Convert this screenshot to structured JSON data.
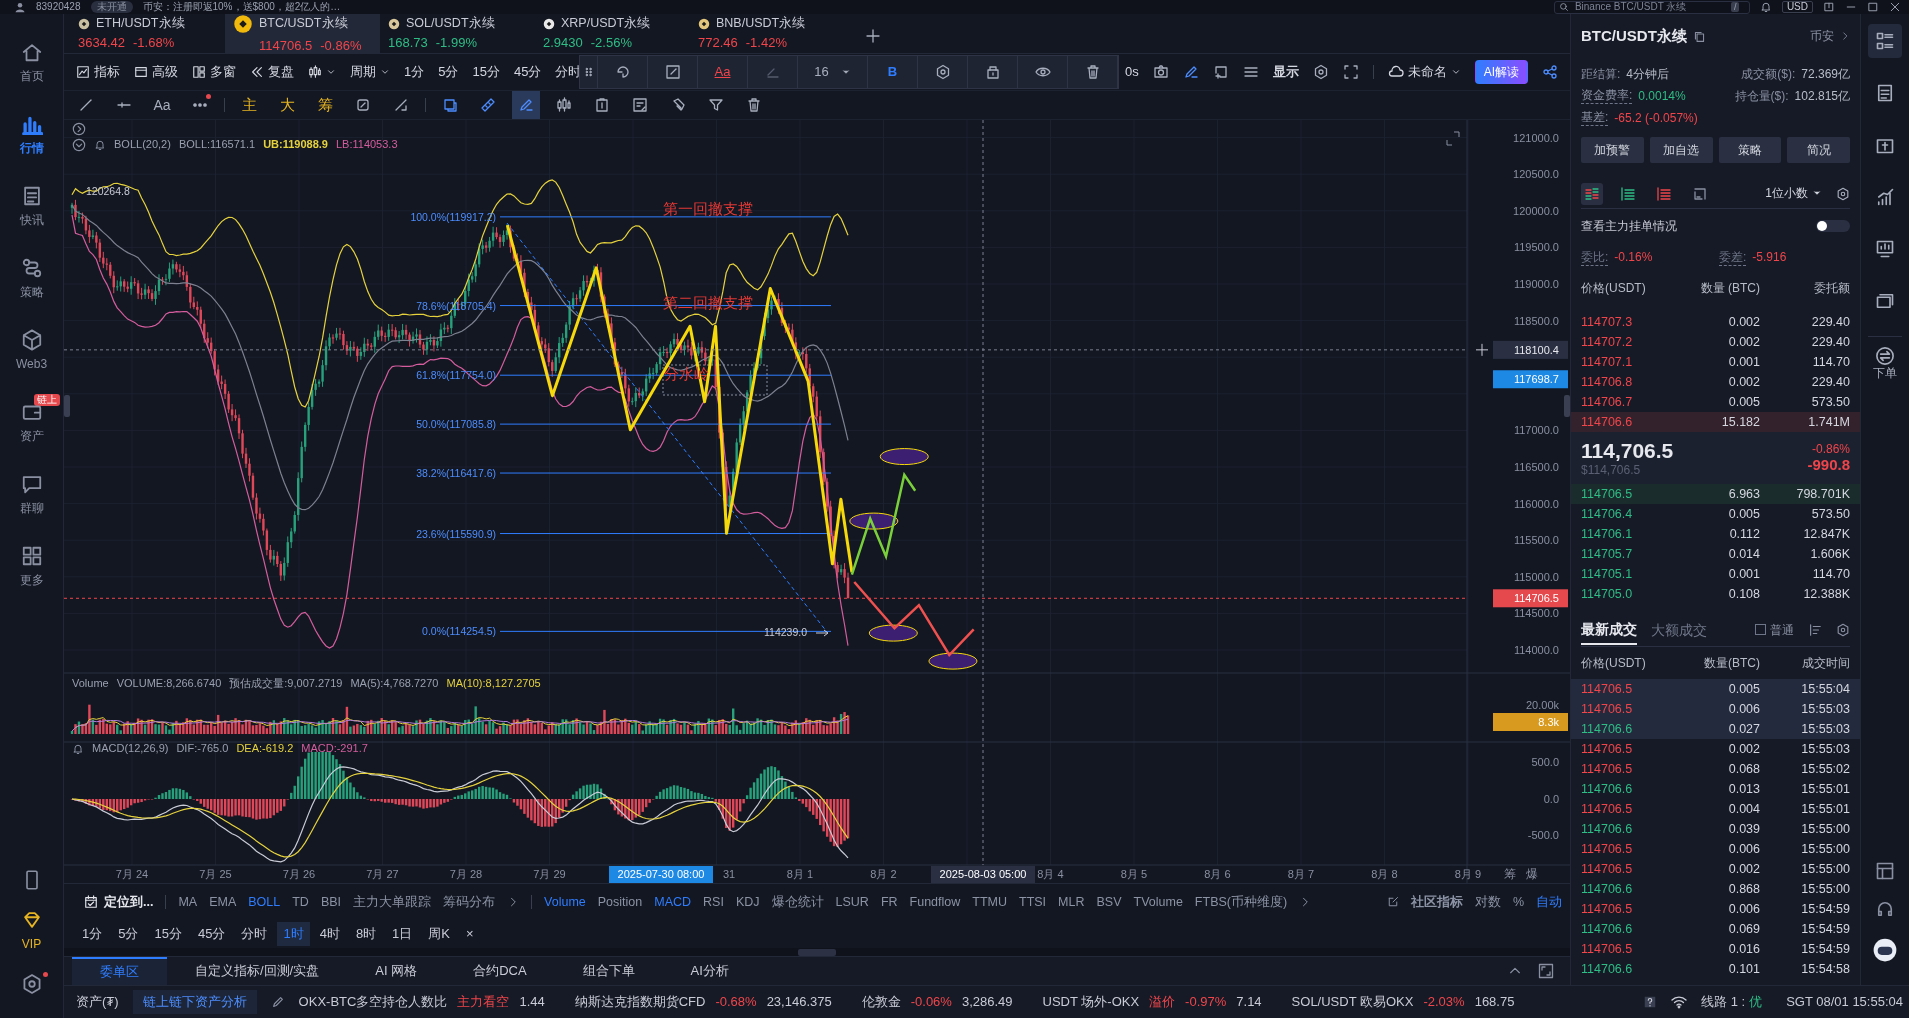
{
  "top_strip": {
    "account_id": "83920428",
    "account_status": "未开通",
    "news": "币安：注册即返10%，送$800，超2亿人的…",
    "search_placeholder": "Binance BTC/USDT 永续",
    "search_shortcut": "/",
    "currency": "USD"
  },
  "sidebar": {
    "items": [
      {
        "label": "首页",
        "kind": "home",
        "selected": false
      },
      {
        "label": "行情",
        "kind": "market",
        "selected": true
      },
      {
        "label": "快讯",
        "kind": "news",
        "selected": false
      },
      {
        "label": "策略",
        "kind": "strategy",
        "selected": false
      },
      {
        "label": "Web3",
        "kind": "web3",
        "selected": false
      },
      {
        "label": "资产",
        "kind": "assets",
        "selected": false,
        "badge": "链上"
      },
      {
        "label": "群聊",
        "kind": "chat",
        "selected": false
      },
      {
        "label": "更多",
        "kind": "more",
        "selected": false
      }
    ],
    "vip_label": "VIP",
    "settings_notice": true
  },
  "symbol_tabs": [
    {
      "name": "ETH/USDT永续",
      "kind": "eth",
      "price": "3634.42",
      "change": "-1.68%",
      "color": "#f0454a",
      "selected": false
    },
    {
      "name": "BTC/USDT永续",
      "kind": "btc",
      "price": "114706.5",
      "change": "-0.86%",
      "color": "#f0454a",
      "selected": true
    },
    {
      "name": "SOL/USDT永续",
      "kind": "sol",
      "price": "168.73",
      "change": "-1.99%",
      "color": "#2ebd85",
      "selected": false
    },
    {
      "name": "XRP/USDT永续",
      "kind": "xrp",
      "price": "2.9430",
      "change": "-2.56%",
      "color": "#2ebd85",
      "selected": false
    },
    {
      "name": "BNB/USDT永续",
      "kind": "bnb",
      "price": "772.46",
      "change": "-1.42%",
      "color": "#f0454a",
      "selected": false
    }
  ],
  "toolbar": {
    "buttons": [
      {
        "kind": "indicator",
        "label": "指标"
      },
      {
        "kind": "advanced",
        "label": "高级"
      },
      {
        "kind": "multi",
        "label": "多窗"
      },
      {
        "kind": "replay",
        "label": "复盘"
      }
    ],
    "period_label": "周期",
    "periods": [
      "1分",
      "5分",
      "15分",
      "45分",
      "分时"
    ],
    "countdown": "0s",
    "display_label": "显示",
    "layout_name": "未命名",
    "ai_button": "AI解读"
  },
  "float_toolbar": {
    "text_style": "Aa",
    "font_size": "16",
    "bold": "B"
  },
  "draw_toolbar": {
    "lead_tools": [
      {
        "kind": "line",
        "selected": false
      },
      {
        "kind": "hline",
        "selected": false
      }
    ],
    "text_tool": "Aa",
    "more_notice": true,
    "overlays": [
      "主",
      "大",
      "筹"
    ],
    "mid_tools": [
      {
        "kind": "cycle",
        "selected": false
      },
      {
        "kind": "measure",
        "selected": false
      }
    ],
    "tools": [
      {
        "kind": "select",
        "selected": false
      },
      {
        "kind": "ruler",
        "selected": false
      },
      {
        "kind": "pen",
        "selected": true
      },
      {
        "kind": "candles",
        "selected": false
      },
      {
        "kind": "upload",
        "selected": false
      },
      {
        "kind": "note",
        "selected": false
      },
      {
        "kind": "magnet",
        "selected": false
      },
      {
        "kind": "filter",
        "selected": false
      },
      {
        "kind": "trash",
        "selected": false
      }
    ]
  },
  "chart": {
    "main_header": {
      "indicator": "BOLL(20,2)",
      "mid": "BOLL:116571.1",
      "upper": "UB:119088.9",
      "lower": "LB:114053.3"
    },
    "high_label": "120264.8",
    "low_label": "114239.0",
    "fib_levels": [
      "100.0%(119917.2)",
      "78.6%(118705.4)",
      "61.8%(117754.0)",
      "50.0%(117085.8)",
      "38.2%(116417.6)",
      "23.6%(115590.9)",
      "0.0%(114254.5)"
    ],
    "annotations": [
      "第一回撤支撑",
      "第二回撤支撑",
      "分水岭"
    ],
    "price_ticks": [
      "121000.0",
      "120500.0",
      "120000.0",
      "119500.0",
      "119000.0",
      "118500.0",
      "117000.0",
      "116500.0",
      "116000.0",
      "115500.0",
      "115000.0",
      "114500.0",
      "114000.0"
    ],
    "crosshair_price": "118100.4",
    "marked_price": "117698.7",
    "last_price": "114706.5",
    "volume_header": {
      "title": "Volume",
      "volume": "VOLUME:8,266.6740",
      "estimate": "预估成交量:9,007.2719",
      "ma5": "MA(5):4,768.7270",
      "ma10": "MA(10):8,127.2705"
    },
    "volume_tick": "20.00k",
    "volume_last": "8.3k",
    "macd_header": {
      "title": "MACD(12,26,9)",
      "dif": "DIF:-765.0",
      "dea": "DEA:-619.2",
      "macd": "MACD:-291.7"
    },
    "macd_ticks": [
      "500.0",
      "0.0",
      "-500.0"
    ],
    "date_labels": [
      "7月 24",
      "7月 25",
      "7月 26",
      "7月 27",
      "7月 28",
      "7月 29",
      "31",
      "8月 1",
      "8月 2",
      "8月 4",
      "8月 5",
      "8月 6",
      "8月 7",
      "8月 8",
      "8月 9"
    ],
    "crosshair_date": "2025-07-30 08:00",
    "cursor_date": "2025-08-03 05:00",
    "axis_buttons": [
      "筹",
      "爆"
    ]
  },
  "bottom": {
    "locate": "定位到...",
    "main_indicators": [
      {
        "label": "MA",
        "active": false
      },
      {
        "label": "EMA",
        "active": false
      },
      {
        "label": "BOLL",
        "active": true
      },
      {
        "label": "TD",
        "active": false
      },
      {
        "label": "BBI",
        "active": false
      },
      {
        "label": "主力大单跟踪",
        "active": false
      },
      {
        "label": "筹码分布",
        "active": false
      }
    ],
    "sub_indicators": [
      {
        "label": "Volume",
        "active": true
      },
      {
        "label": "Position",
        "active": false
      },
      {
        "label": "MACD",
        "active": true
      },
      {
        "label": "RSI",
        "active": false
      },
      {
        "label": "KDJ",
        "active": false
      },
      {
        "label": "爆仓统计",
        "active": false
      },
      {
        "label": "LSUR",
        "active": false
      },
      {
        "label": "FR",
        "active": false
      },
      {
        "label": "Fundflow",
        "active": false
      },
      {
        "label": "TTMU",
        "active": false
      },
      {
        "label": "TTSI",
        "active": false
      },
      {
        "label": "MLR",
        "active": false
      },
      {
        "label": "BSV",
        "active": false
      },
      {
        "label": "TVolume",
        "active": false
      },
      {
        "label": "FTBS(币种维度)",
        "active": false
      }
    ],
    "community": "社区指标",
    "log": "对数",
    "percent": "%",
    "auto": {
      "label": "自动",
      "active": true
    },
    "periods": [
      {
        "label": "1分",
        "selected": false
      },
      {
        "label": "5分",
        "selected": false
      },
      {
        "label": "15分",
        "selected": false
      },
      {
        "label": "45分",
        "selected": false
      },
      {
        "label": "分时",
        "selected": false
      },
      {
        "label": "1时",
        "selected": true
      },
      {
        "label": "4时",
        "selected": false
      },
      {
        "label": "8时",
        "selected": false
      },
      {
        "label": "1日",
        "selected": false
      },
      {
        "label": "周K",
        "selected": false
      }
    ],
    "close": "×",
    "panel_tabs": [
      {
        "label": "委单区",
        "selected": true
      },
      {
        "label": "自定义指标/回测/实盘",
        "selected": false
      },
      {
        "label": "AI 网格",
        "selected": false
      },
      {
        "label": "合约DCA",
        "selected": false
      },
      {
        "label": "组合下单",
        "selected": false
      },
      {
        "label": "AI分析",
        "selected": false
      }
    ]
  },
  "right_panel": {
    "title": "BTC/USDT永续",
    "exchange": "币安",
    "stats": [
      {
        "label": "距结算:",
        "value": "4分钟后",
        "color": "#b8bdca"
      },
      {
        "label": "成交额($):",
        "value": "72.369亿",
        "color": "#b8bdca"
      },
      {
        "label": "资金费率:",
        "value": "0.0014%",
        "color": "#2ebd85"
      },
      {
        "label": "持仓量($):",
        "value": "102.815亿",
        "color": "#b8bdca"
      },
      {
        "label": "基差:",
        "value": "-65.2 (-0.057%)",
        "color": "#f0454a"
      }
    ],
    "buttons": [
      "加预警",
      "加自选",
      "策略",
      "简况"
    ],
    "book_views": [
      {
        "kind": "both",
        "selected": true
      },
      {
        "kind": "bids",
        "selected": false
      },
      {
        "kind": "asks",
        "selected": false
      },
      {
        "kind": "depth",
        "selected": false
      }
    ],
    "precision": "1位小数",
    "whale_toggle": {
      "label": "查看主力挂单情况",
      "on": false
    },
    "ratio": {
      "label": "委比:",
      "value": "-0.16%"
    },
    "diff": {
      "label": "委差:",
      "value": "-5.916"
    },
    "columns": [
      "价格(USDT)",
      "数量 (BTC)",
      "委托额"
    ],
    "asks": [
      {
        "price": "114707.3",
        "amount": "0.002",
        "total": "229.40",
        "highlighted": false
      },
      {
        "price": "114707.2",
        "amount": "0.002",
        "total": "229.40",
        "highlighted": false
      },
      {
        "price": "114707.1",
        "amount": "0.001",
        "total": "114.70",
        "highlighted": false
      },
      {
        "price": "114706.8",
        "amount": "0.002",
        "total": "229.40",
        "highlighted": false
      },
      {
        "price": "114706.7",
        "amount": "0.005",
        "total": "573.50",
        "highlighted": false
      },
      {
        "price": "114706.6",
        "amount": "15.182",
        "total": "1.741M",
        "highlighted": true
      }
    ],
    "mid": {
      "price": "114,706.5",
      "usd": "$114,706.5",
      "change_pct": "-0.86%",
      "change": "-990.8"
    },
    "bids": [
      {
        "price": "114706.5",
        "amount": "6.963",
        "total": "798.701K",
        "highlighted": true
      },
      {
        "price": "114706.4",
        "amount": "0.005",
        "total": "573.50",
        "highlighted": false
      },
      {
        "price": "114706.1",
        "amount": "0.112",
        "total": "12.847K",
        "highlighted": false
      },
      {
        "price": "114705.7",
        "amount": "0.014",
        "total": "1.606K",
        "highlighted": false
      },
      {
        "price": "114705.1",
        "amount": "0.001",
        "total": "114.70",
        "highlighted": false
      },
      {
        "price": "114705.0",
        "amount": "0.108",
        "total": "12.388K",
        "highlighted": false
      }
    ],
    "trade_tabs": [
      {
        "label": "最新成交",
        "selected": true
      },
      {
        "label": "大额成交",
        "selected": false
      }
    ],
    "normal_filter": {
      "label": "普通",
      "checked": false
    },
    "trade_columns": [
      "价格(USDT)",
      "数量(BTC)",
      "成交时间"
    ],
    "trades": [
      {
        "price": "114706.5",
        "amount": "0.005",
        "time": "15:55:04",
        "kind": "sell",
        "highlighted": true
      },
      {
        "price": "114706.5",
        "amount": "0.006",
        "time": "15:55:03",
        "kind": "sell",
        "highlighted": true
      },
      {
        "price": "114706.6",
        "amount": "0.027",
        "time": "15:55:03",
        "kind": "buy",
        "highlighted": true
      },
      {
        "price": "114706.5",
        "amount": "0.002",
        "time": "15:55:03",
        "kind": "sell",
        "highlighted": false
      },
      {
        "price": "114706.5",
        "amount": "0.068",
        "time": "15:55:02",
        "kind": "sell",
        "highlighted": false
      },
      {
        "price": "114706.6",
        "amount": "0.013",
        "time": "15:55:01",
        "kind": "buy",
        "highlighted": false
      },
      {
        "price": "114706.5",
        "amount": "0.004",
        "time": "15:55:01",
        "kind": "sell",
        "highlighted": false
      },
      {
        "price": "114706.6",
        "amount": "0.039",
        "time": "15:55:00",
        "kind": "buy",
        "highlighted": false
      },
      {
        "price": "114706.5",
        "amount": "0.006",
        "time": "15:55:00",
        "kind": "sell",
        "highlighted": false
      },
      {
        "price": "114706.5",
        "amount": "0.002",
        "time": "15:55:00",
        "kind": "sell",
        "highlighted": false
      },
      {
        "price": "114706.6",
        "amount": "0.868",
        "time": "15:55:00",
        "kind": "buy",
        "highlighted": false
      },
      {
        "price": "114706.5",
        "amount": "0.006",
        "time": "15:54:59",
        "kind": "sell",
        "highlighted": false
      },
      {
        "price": "114706.6",
        "amount": "0.069",
        "time": "15:54:59",
        "kind": "buy",
        "highlighted": false
      },
      {
        "price": "114706.5",
        "amount": "0.016",
        "time": "15:54:59",
        "kind": "sell",
        "highlighted": false
      },
      {
        "price": "114706.6",
        "amount": "0.101",
        "time": "15:54:58",
        "kind": "buy",
        "highlighted": false
      }
    ]
  },
  "right_bar": {
    "tools": [
      {
        "kind": "orderbook",
        "selected": true
      },
      {
        "kind": "notes",
        "selected": false
      },
      {
        "kind": "deposit",
        "selected": false
      },
      {
        "kind": "signal",
        "selected": false
      },
      {
        "kind": "monitor",
        "selected": false
      },
      {
        "kind": "etf",
        "selected": false
      }
    ],
    "order_label": "下单"
  },
  "status_bar": {
    "assets_label": "资产(₮)",
    "asset_analysis": "链上链下资产分析",
    "tickers": [
      {
        "name": "OKX-BTC多空持仓人数比",
        "tag": "主力看空",
        "value": "1.44"
      },
      {
        "name": "纳斯达克指数期货CFD",
        "change": "-0.68%",
        "value": "23,146.375"
      },
      {
        "name": "伦敦金",
        "change": "-0.06%",
        "value": "3,286.49"
      },
      {
        "name": "USDT 场外-OKX",
        "tag": "溢价",
        "change": "-0.97%",
        "value": "7.14"
      },
      {
        "name": "SOL/USDT 欧易OKX",
        "change": "-2.03%",
        "value": "168.75"
      }
    ],
    "line_label": "线路 1 :",
    "line_quality": "优",
    "clock": "SGT 08/01 15:55:04"
  }
}
